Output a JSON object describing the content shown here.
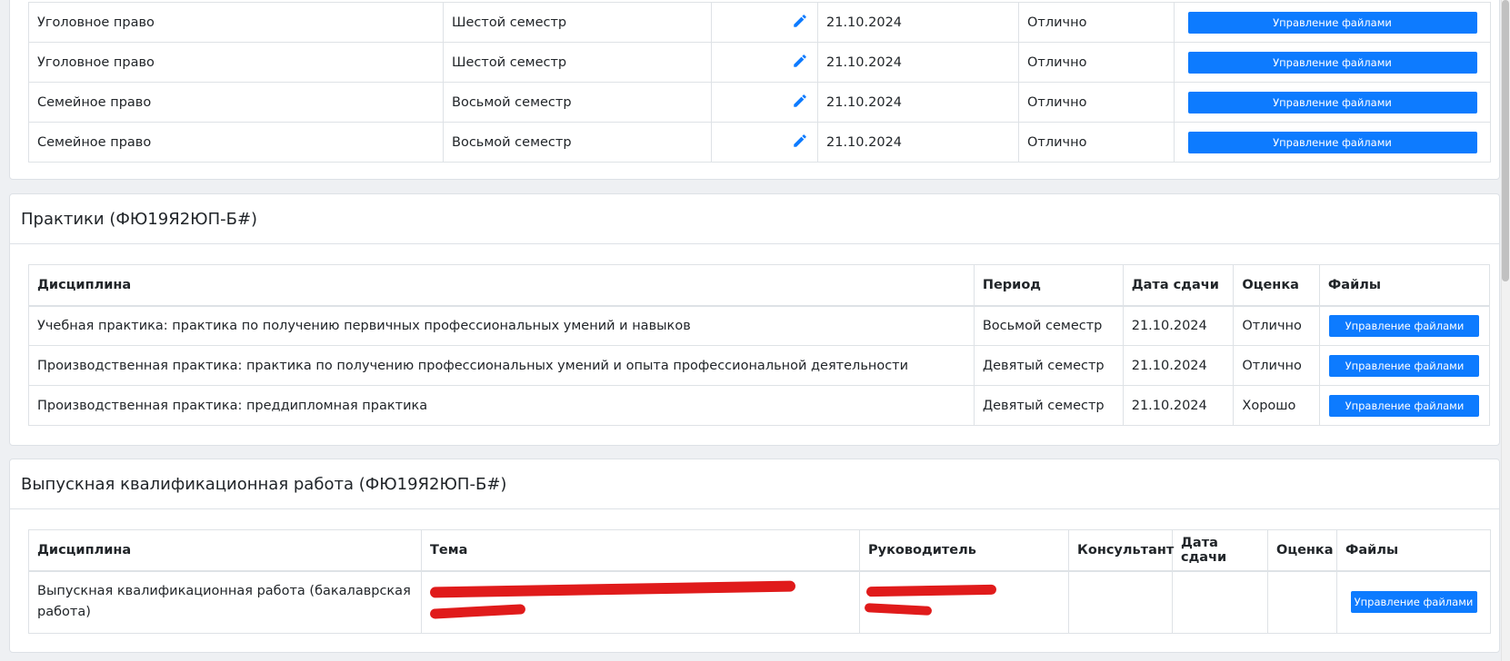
{
  "courses_table": {
    "rows": [
      {
        "discipline": "Уголовное право",
        "period": "Шестой семестр",
        "date": "21.10.2024",
        "grade": "Отлично",
        "button": "Управление файлами"
      },
      {
        "discipline": "Уголовное право",
        "period": "Шестой семестр",
        "date": "21.10.2024",
        "grade": "Отлично",
        "button": "Управление файлами"
      },
      {
        "discipline": "Семейное право",
        "period": "Восьмой семестр",
        "date": "21.10.2024",
        "grade": "Отлично",
        "button": "Управление файлами"
      },
      {
        "discipline": "Семейное право",
        "period": "Восьмой семестр",
        "date": "21.10.2024",
        "grade": "Отлично",
        "button": "Управление файлами"
      }
    ]
  },
  "practices": {
    "title": "Практики (ФЮ19Я2ЮП-Б#)",
    "headers": {
      "discipline": "Дисциплина",
      "period": "Период",
      "date": "Дата сдачи",
      "grade": "Оценка",
      "files": "Файлы"
    },
    "rows": [
      {
        "discipline": "Учебная практика: практика по получению первичных профессиональных умений и навыков",
        "period": "Восьмой семестр",
        "date": "21.10.2024",
        "grade": "Отлично",
        "button": "Управление файлами"
      },
      {
        "discipline": "Производственная практика: практика по получению профессиональных умений и опыта профессиональной деятельности",
        "period": "Девятый семестр",
        "date": "21.10.2024",
        "grade": "Отлично",
        "button": "Управление файлами"
      },
      {
        "discipline": "Производственная практика: преддипломная практика",
        "period": "Девятый семестр",
        "date": "21.10.2024",
        "grade": "Хорошо",
        "button": "Управление файлами"
      }
    ]
  },
  "vkr": {
    "title": "Выпускная квалификационная работа (ФЮ19Я2ЮП-Б#)",
    "headers": {
      "discipline": "Дисциплина",
      "topic": "Тема",
      "supervisor": "Руководитель",
      "consultant": "Консультант",
      "date": "Дата сдачи",
      "grade": "Оценка",
      "files": "Файлы"
    },
    "row": {
      "discipline": "Выпускная квалификационная работа (бакалаврская работа)",
      "topic": "",
      "supervisor": "",
      "consultant": "",
      "date": "",
      "grade": "",
      "button": "Управление файлами"
    }
  },
  "colors": {
    "accent": "#0d7bff",
    "redaction": "#e01b1b"
  }
}
